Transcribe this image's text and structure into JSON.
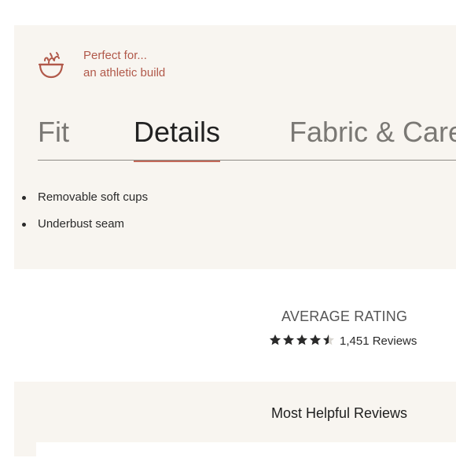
{
  "perfect_for": {
    "icon": "bowl-icon",
    "title": "Perfect for...",
    "subtitle": "an athletic build",
    "accent_color": "#b1594a"
  },
  "tabs": [
    {
      "label": "Fit",
      "active": false
    },
    {
      "label": "Details",
      "active": true
    },
    {
      "label": "Fabric & Care",
      "active": false
    }
  ],
  "details": {
    "items": [
      "Removable soft cups",
      "Underbust seam"
    ]
  },
  "rating": {
    "label": "AVERAGE RATING",
    "stars_value": 4.5,
    "stars_max": 5,
    "reviews_count_text": "1,451 Reviews"
  },
  "reviews": {
    "heading": "Most Helpful Reviews"
  }
}
